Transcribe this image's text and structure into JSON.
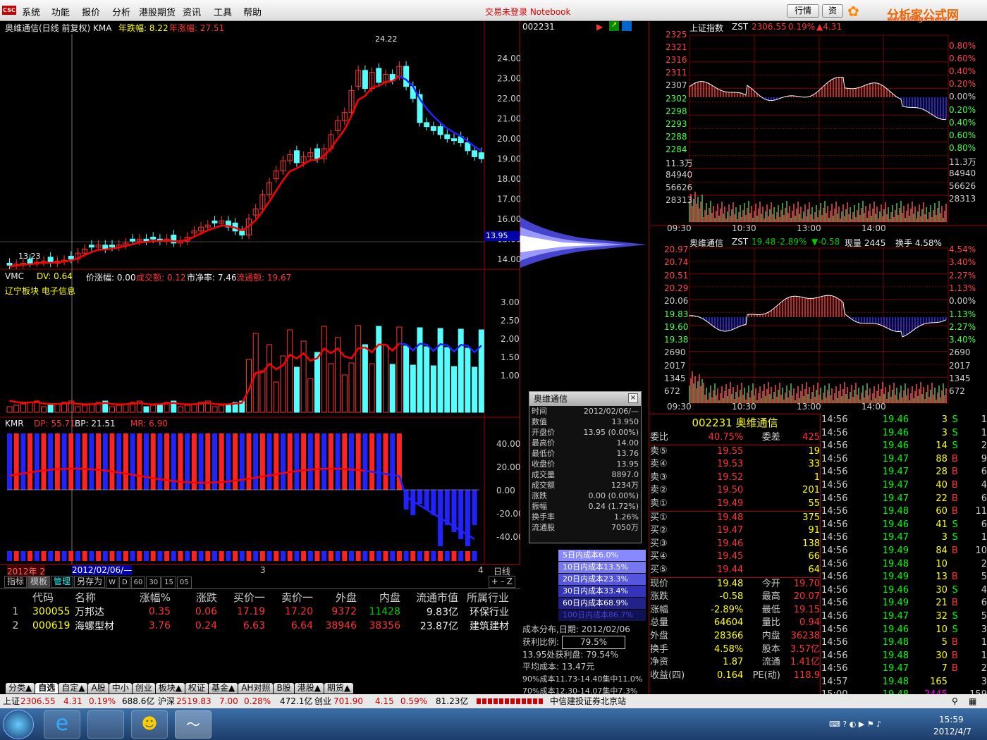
{
  "menubar": {
    "items": [
      "系统",
      "功能",
      "报价",
      "分析",
      "港股期货",
      "资讯",
      "工具",
      "帮助"
    ],
    "title": "交易未登录 Notebook",
    "btn_quote": "行情",
    "btn_info": "资",
    "brand": "分析家公式网",
    "brand_url": "www.88gs.com"
  },
  "main_chart": {
    "title": "奥维通信(日线 前复权) KMA",
    "year_drop": "年跌幅: 8.22",
    "year_rise": "年涨幅: 27.51",
    "price_labels": [
      "24.00",
      "23.00",
      "22.00",
      "21.00",
      "20.00",
      "19.00",
      "18.00",
      "17.00",
      "16.00",
      "15.00",
      "14.00"
    ],
    "current": "13.95",
    "high_mark": "24.22",
    "low_mark": "13.23"
  },
  "vol_panel": {
    "name": "VMC",
    "dv": "DV: 0.64",
    "price_chg": "价涨幅: 0.00",
    "amount": "成交额: 0.12",
    "pb": "市净率: 7.46",
    "float": "流通额: 19.67",
    "sector": "辽宁板块 电子信息",
    "scale": [
      "3.00",
      "2.50",
      "2.00",
      "1.50",
      "1.00"
    ]
  },
  "kmr_panel": {
    "name": "KMR",
    "dp": "DP: 55.71",
    "bp": "BP: 21.51",
    "mr": "MR: 6.90",
    "scale": [
      "40.00",
      "20.00",
      "0.00",
      "-20.00",
      "-40.00"
    ]
  },
  "timeline": {
    "year": "2012年 2",
    "date": "2012/02/06/—",
    "m3": "3",
    "m4": "4",
    "period": "日线"
  },
  "toolbar": {
    "tabs": [
      "指标",
      "模板",
      "管理",
      "另存为"
    ],
    "periods": [
      "W",
      "D",
      "60",
      "30",
      "15",
      "05"
    ]
  },
  "quote_table": {
    "headers": [
      "代码",
      "名称",
      "涨幅%",
      "涨跌",
      "买价一",
      "卖价一",
      "外盘",
      "内盘",
      "流通市值",
      "所属行业"
    ],
    "rows": [
      {
        "n": "1",
        "code": "300055",
        "name": "万邦达",
        "chg": "0.35",
        "diff": "0.06",
        "bid": "17.19",
        "ask": "17.20",
        "outer": "9372",
        "inner": "11428",
        "cap": "9.83亿",
        "ind": "环保行业"
      },
      {
        "n": "2",
        "code": "000619",
        "name": "海螺型材",
        "chg": "3.76",
        "diff": "0.24",
        "bid": "6.63",
        "ask": "6.64",
        "outer": "38946",
        "inner": "38356",
        "cap": "23.87亿",
        "ind": "建筑建材"
      }
    ]
  },
  "bottom_tabs": [
    "分类▲",
    "自选",
    "自定▲",
    "A股",
    "中小",
    "创业",
    "板块▲",
    "权证",
    "基金▲",
    "AH对照",
    "B股",
    "港股▲",
    "期货▲"
  ],
  "chip": {
    "code": "002231",
    "popup_title": "奥维通信",
    "rows": [
      [
        "时间",
        "2012/02/06/—"
      ],
      [
        "数值",
        "13.950"
      ],
      [
        "开盘价",
        "13.95 (0.00%)"
      ],
      [
        "最高价",
        "14.00"
      ],
      [
        "最低价",
        "13.76"
      ],
      [
        "收盘价",
        "13.95"
      ],
      [
        "成交量",
        "8897.0"
      ],
      [
        "成交额",
        "1234万"
      ],
      [
        "涨跌",
        "0.00 (0.00%)"
      ],
      [
        "振幅",
        "0.24 (1.72%)"
      ],
      [
        "换手率",
        "1.26%"
      ],
      [
        "流通股",
        "7050万"
      ]
    ],
    "costs": [
      "5日内成本6.0%",
      "10日内成本13.5%",
      "20日内成本23.3%",
      "30日内成本33.4%",
      "60日内成本68.9%",
      "100日内成本86.7%"
    ],
    "date": "成本分布,日期: 2012/02/06",
    "profit_label": "获利比例:",
    "profit": "79.5%",
    "line1": "13.95处获利盘: 79.54%",
    "line2": "平均成本: 13.47元",
    "line3": "90%成本11.73-14.40集中11.0%",
    "line4": "70%成本12.30-14.07集中7.3%"
  },
  "index_chart": {
    "title": "上证指数",
    "zst": "ZST",
    "price": "2306.55",
    "pct": "0.19%",
    "chg": "▲4.31",
    "left": [
      "2325",
      "2321",
      "2316",
      "2311",
      "2307",
      "2302",
      "2298",
      "2293",
      "2288",
      "2284",
      "11.3万",
      "84940",
      "56626",
      "28313"
    ],
    "right": [
      "0.80%",
      "0.60%",
      "0.40%",
      "0.20%",
      "0.00%",
      "0.20%",
      "0.40%",
      "0.60%",
      "0.80%",
      "11.3万",
      "84940",
      "56626",
      "28313"
    ],
    "times": [
      "09:30",
      "10:30",
      "13:00",
      "14:00"
    ]
  },
  "stock_chart": {
    "title": "奥维通信",
    "zst": "ZST",
    "price": "19.48",
    "pct": "-2.89%",
    "chg": "▼-0.58",
    "vol": "现量 2445",
    "turn": "换手 4.58%",
    "left": [
      "20.97",
      "20.74",
      "20.51",
      "20.29",
      "20.06",
      "19.83",
      "19.60",
      "19.38",
      "2690",
      "2017",
      "1345",
      "672"
    ],
    "right": [
      "4.54%",
      "3.40%",
      "2.27%",
      "1.13%",
      "0.00%",
      "1.13%",
      "2.27%",
      "3.40%",
      "2690",
      "2017",
      "1345",
      "672"
    ],
    "times": [
      "09:30",
      "10:30",
      "13:00",
      "14:00"
    ]
  },
  "orderbook": {
    "code": "002231",
    "name": "奥维通信",
    "ratio_label": "委比",
    "ratio": "40.75%",
    "diff_label": "委差",
    "diff": "425",
    "asks": [
      [
        "卖⑤",
        "19.55",
        "19"
      ],
      [
        "卖④",
        "19.53",
        "33"
      ],
      [
        "卖③",
        "19.52",
        "1"
      ],
      [
        "卖②",
        "19.50",
        "201"
      ],
      [
        "卖①",
        "19.49",
        "55"
      ]
    ],
    "bids": [
      [
        "买①",
        "19.48",
        "375"
      ],
      [
        "买②",
        "19.47",
        "91"
      ],
      [
        "买③",
        "19.46",
        "138"
      ],
      [
        "买④",
        "19.45",
        "66"
      ],
      [
        "买⑤",
        "19.44",
        "64"
      ]
    ],
    "stats": [
      [
        "现价",
        "19.48",
        "今开",
        "19.70"
      ],
      [
        "涨跌",
        "-0.58",
        "最高",
        "20.07"
      ],
      [
        "涨幅",
        "-2.89%",
        "最低",
        "19.15"
      ],
      [
        "总量",
        "64604",
        "量比",
        "0.94"
      ],
      [
        "外盘",
        "28366",
        "内盘",
        "36238"
      ],
      [
        "换手",
        "4.58%",
        "股本",
        "3.57亿"
      ],
      [
        "净资",
        "1.87",
        "流通",
        "1.41亿"
      ],
      [
        "收益(四)",
        "0.164",
        "PE(动)",
        "118.9"
      ]
    ]
  },
  "ticks": [
    [
      "14:56",
      "19.46",
      "3",
      "S",
      "1"
    ],
    [
      "14:56",
      "19.46",
      "3",
      "S",
      "1"
    ],
    [
      "14:56",
      "19.46",
      "14",
      "S",
      "2"
    ],
    [
      "14:56",
      "19.47",
      "88",
      "B",
      "9"
    ],
    [
      "14:56",
      "19.47",
      "28",
      "B",
      "6"
    ],
    [
      "14:56",
      "19.47",
      "40",
      "B",
      "4"
    ],
    [
      "14:56",
      "19.47",
      "22",
      "B",
      "6"
    ],
    [
      "14:56",
      "19.48",
      "60",
      "B",
      "11"
    ],
    [
      "14:56",
      "19.46",
      "41",
      "S",
      "6"
    ],
    [
      "14:56",
      "19.47",
      "3",
      "S",
      "1"
    ],
    [
      "14:56",
      "19.49",
      "84",
      "B",
      "10"
    ],
    [
      "14:56",
      "19.48",
      "10",
      "",
      "2"
    ],
    [
      "14:56",
      "19.49",
      "13",
      "B",
      "5"
    ],
    [
      "14:56",
      "19.46",
      "30",
      "S",
      "4"
    ],
    [
      "14:56",
      "19.49",
      "21",
      "B",
      "6"
    ],
    [
      "14:56",
      "19.47",
      "32",
      "S",
      "5"
    ],
    [
      "14:56",
      "19.46",
      "10",
      "S",
      "3"
    ],
    [
      "14:56",
      "19.48",
      "5",
      "B",
      "1"
    ],
    [
      "14:56",
      "19.48",
      "30",
      "B",
      "1"
    ],
    [
      "14:56",
      "19.47",
      "7",
      "B",
      "2"
    ],
    [
      "14:57",
      "19.48",
      "165",
      "",
      "3"
    ],
    [
      "15:00",
      "19.48",
      "2445",
      "",
      "159"
    ]
  ],
  "statusbar": {
    "sh_label": "上证",
    "sh": "2306.55",
    "sh_chg": "4.31",
    "sh_pct": "0.19%",
    "sh_amt": "688.6亿",
    "sz_label": "沪深",
    "sz": "2519.83",
    "sz_chg": "7.00",
    "sz_pct": "0.28%",
    "sz_amt": "472.1亿",
    "cy_label": "创业",
    "cy": "701.90",
    "cy_chg": "4.15",
    "cy_pct": "0.59%",
    "cy_amt": "81.23亿",
    "broker": "中信建投证券北京站"
  },
  "taskbar": {
    "time": "15:59",
    "date": "2012/4/7"
  }
}
